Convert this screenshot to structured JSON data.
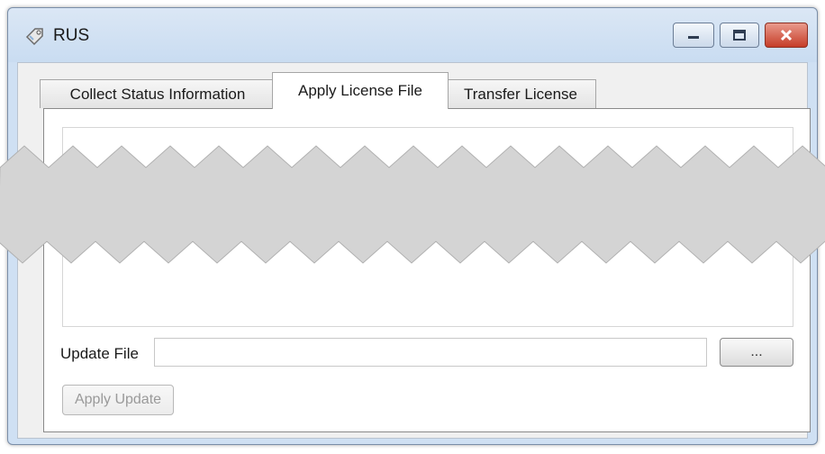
{
  "window": {
    "title": "RUS",
    "app_icon": "key-tag-icon"
  },
  "title_buttons": {
    "minimize": "minimize-icon",
    "maximize": "maximize-icon",
    "close": "close-icon"
  },
  "tabs": [
    {
      "label": "Collect Status Information",
      "active": false
    },
    {
      "label": "Apply License File",
      "active": true
    },
    {
      "label": "Transfer License",
      "active": false
    }
  ],
  "form": {
    "update_file_label": "Update File",
    "update_file_value": "",
    "browse_label": "...",
    "apply_label": "Apply Update",
    "apply_enabled": false
  },
  "colors": {
    "close_button": "#c63d28",
    "titlebar": "#cfe0f3",
    "tear_band": "#d4d4d4"
  }
}
